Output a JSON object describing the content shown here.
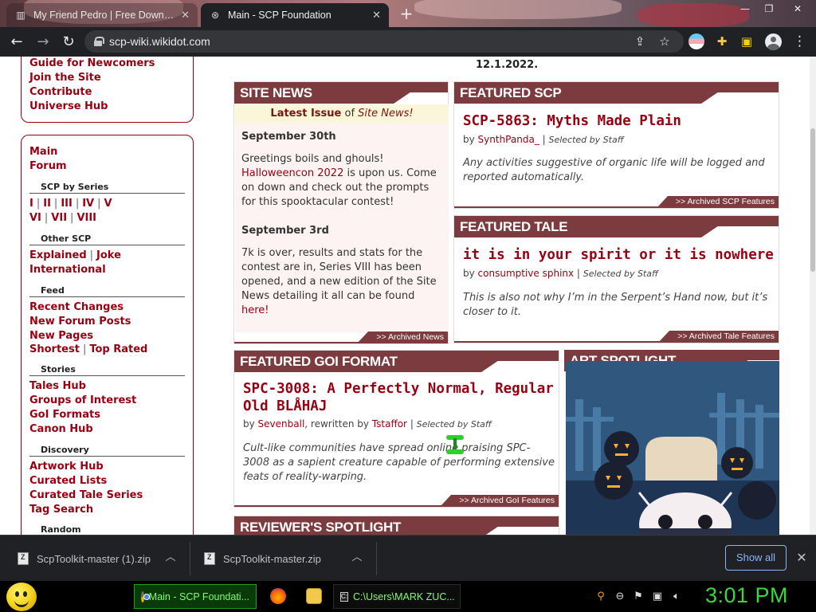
{
  "browser": {
    "tabs": [
      {
        "title": "My Friend Pedro | Free Downloa",
        "favicon": "book-icon",
        "active": false
      },
      {
        "title": "Main - SCP Foundation",
        "favicon": "scp-logo-icon",
        "active": true
      }
    ],
    "new_tab": "+",
    "url": "scp-wiki.wikidot.com"
  },
  "sidebar": {
    "top_links": [
      "Guide for Newcomers",
      "Join the Site",
      "Contribute",
      "Universe Hub"
    ],
    "main_links": [
      "Main",
      "Forum"
    ],
    "sections": {
      "scp_by_series": {
        "heading": "SCP by Series",
        "row1": [
          "I",
          "II",
          "III",
          "IV",
          "V"
        ],
        "row2": [
          "VI",
          "VII",
          "VIII"
        ]
      },
      "other_scp": {
        "heading": "Other SCP",
        "row1": [
          "Explained",
          "Joke"
        ],
        "row2": [
          "International"
        ]
      },
      "feed": {
        "heading": "Feed",
        "links": [
          "Recent Changes",
          "New Forum Posts",
          "New Pages"
        ],
        "last_row": [
          "Shortest",
          "Top Rated"
        ]
      },
      "stories": {
        "heading": "Stories",
        "links": [
          "Tales Hub",
          "Groups of Interest",
          "GoI Formats",
          "Canon Hub"
        ]
      },
      "discovery": {
        "heading": "Discovery",
        "links": [
          "Artwork Hub",
          "Curated Lists",
          "Curated Tale Series",
          "Tag Search"
        ]
      },
      "random": {
        "heading": "Random"
      }
    }
  },
  "main": {
    "date_line": "12.1.2022.",
    "site_news": {
      "header": "SITE NEWS",
      "banner_bold": "Latest Issue",
      "banner_of": " of ",
      "banner_italic": "Site News!",
      "items": [
        {
          "date": "September 30th",
          "pre": "Greetings boils and ghouls! ",
          "link": "Halloweencon 2022",
          "post": " is upon us. Come on down and check out the prompts for this spooktacular contest!"
        },
        {
          "date": "September 3rd",
          "pre": "7k is over, results and stats for the contest are in, Series VIII has been opened, and a new edition of the Site News detailing it all can be found ",
          "link": "here!",
          "post": ""
        }
      ],
      "footer": ">> Archived News"
    },
    "featured_scp": {
      "header": "FEATURED SCP",
      "title": "SCP-5863: Myths Made Plain",
      "by": "by ",
      "author": "SynthPanda_",
      "selected": "Selected by Staff",
      "quote": "Any activities suggestive of organic life will be logged and reported automatically.",
      "footer": ">> Archived SCP Features"
    },
    "featured_tale": {
      "header": "FEATURED TALE",
      "title": "it is in your spirit or it is nowhere",
      "by": "by ",
      "author": "consumptive sphinx",
      "selected": "Selected by Staff",
      "quote": "This is also not why I’m in the Serpent’s Hand now, but it’s closer to it.",
      "footer": ">> Archived Tale Features"
    },
    "featured_goi": {
      "header": "FEATURED GOI FORMAT",
      "title": "SPC-3008: A Perfectly Normal, Regular Old BLÅHAJ",
      "by": "by ",
      "author": "Sevenball",
      "rewritten": ", rewritten by ",
      "author2": "Tstaffor",
      "selected": "Selected by Staff",
      "quote": "Cult-like communities have spread online praising SPC-3008 as a sapient creature capable of performing extensive feats of reality-warping.",
      "footer": ">> Archived GoI Features"
    },
    "art_spotlight": {
      "header": "ART SPOTLIGHT"
    },
    "reviewers_spotlight": {
      "header": "REVIEWER'S SPOTLIGHT"
    }
  },
  "downloads": {
    "items": [
      "ScpToolkit-master (1).zip",
      "ScpToolkit-master.zip"
    ],
    "show_all": "Show all"
  },
  "taskbar": {
    "tasks": [
      {
        "label": "Main - SCP Foundati...",
        "icon": "chrome-icon"
      },
      {
        "label": "C:\\Users\\MARK ZUC...",
        "icon": "cmd-icon"
      }
    ],
    "clock": "3:01 PM"
  },
  "colors": {
    "scp_red": "#990011",
    "panel_header": "#7c3b3e",
    "clock_green": "#3ad83a"
  }
}
